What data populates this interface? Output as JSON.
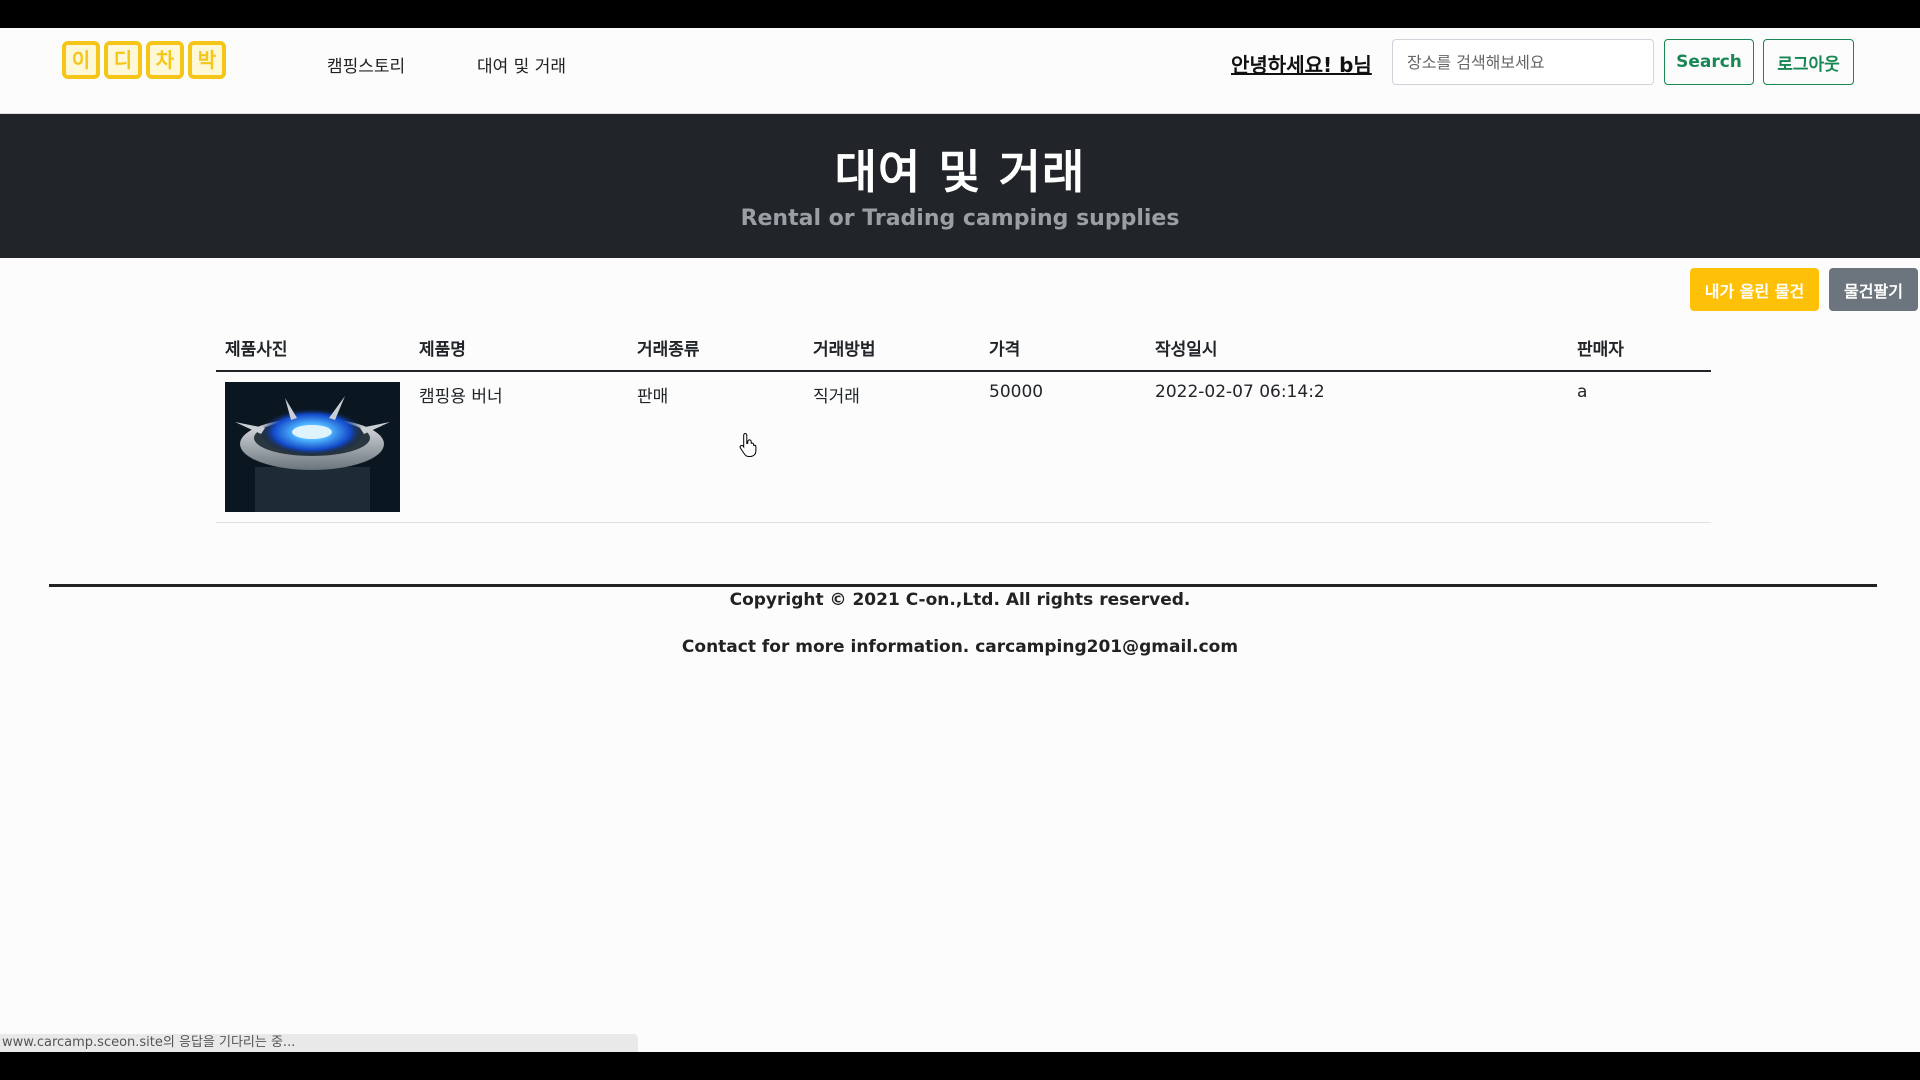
{
  "navbar": {
    "logo_chars": [
      "이",
      "디",
      "차",
      "박"
    ],
    "links": [
      "캠핑스토리",
      "대여 및 거래"
    ],
    "greeting": "안녕하세요! b님",
    "search_placeholder": "장소를 검색해보세요",
    "search_button": "Search",
    "logout_button": "로그아웃"
  },
  "hero": {
    "title": "대여 및 거래",
    "subtitle": "Rental or Trading camping supplies"
  },
  "actions": {
    "my_items": "내가 올린 물건",
    "sell_item": "물건팔기"
  },
  "table": {
    "headers": [
      "제품사진",
      "제품명",
      "거래종류",
      "거래방법",
      "가격",
      "작성일시",
      "판매자"
    ],
    "rows": [
      {
        "image_alt": "camping-burner-photo",
        "name": "캠핑용 버너",
        "trade_type": "판매",
        "trade_method": "직거래",
        "price": "50000",
        "created": "2022-02-07 06:14:2",
        "seller": "a"
      }
    ]
  },
  "footer": {
    "copyright": "Copyright © 2021 C-on.,Ltd. All rights reserved.",
    "contact": "Contact for more information. carcamping201@gmail.com"
  },
  "status_bar": "www.carcamp.sceon.site의 응답을 기다리는 중...",
  "colors": {
    "accent_yellow": "#ffc107",
    "success_green": "#198754",
    "hero_bg": "#212529",
    "secondary_gray": "#6c757d"
  }
}
